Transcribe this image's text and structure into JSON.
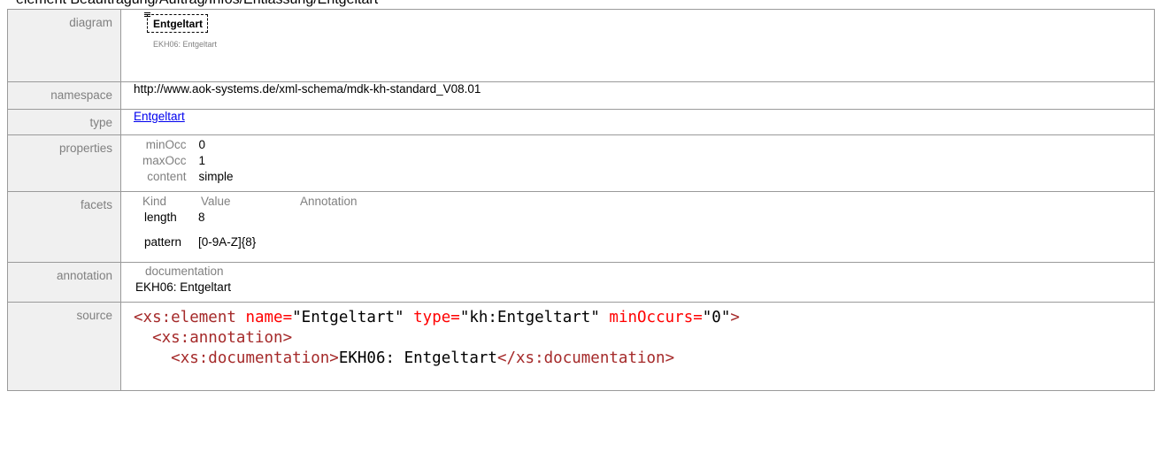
{
  "heading": "element Beauftragung/Auftrag/Infos/Entlassung/Entgeltart",
  "labels": {
    "diagram": "diagram",
    "namespace": "namespace",
    "type": "type",
    "properties": "properties",
    "facets": "facets",
    "annotation": "annotation",
    "source": "source"
  },
  "diagram": {
    "element_name": "Entgeltart",
    "annotation": "EKH06: Entgeltart"
  },
  "namespace": "http://www.aok-systems.de/xml-schema/mdk-kh-standard_V08.01",
  "type_link": "Entgeltart",
  "properties": [
    {
      "key": "minOcc",
      "value": "0"
    },
    {
      "key": "maxOcc",
      "value": "1"
    },
    {
      "key": "content",
      "value": "simple"
    }
  ],
  "facets": {
    "headers": [
      "Kind",
      "Value",
      "Annotation"
    ],
    "rows": [
      {
        "kind": "length",
        "value": "8"
      },
      {
        "kind": "pattern",
        "value": "[0-9A-Z]{8}"
      }
    ]
  },
  "annotation": {
    "heading": "documentation",
    "text": "EKH06: Entgeltart"
  },
  "source": {
    "line1": {
      "open": "<xs:element",
      "attr1_name": "name=",
      "attr1_value": "\"Entgeltart\"",
      "attr2_name": "type=",
      "attr2_value": "\"kh:Entgeltart\"",
      "attr3_name": "minOccurs=",
      "attr3_value": "\"0\"",
      "close": ">"
    },
    "line2": "<xs:annotation>",
    "line3": {
      "open": "<xs:documentation>",
      "text": "EKH06: Entgeltart",
      "close": "</xs:documentation>"
    }
  }
}
